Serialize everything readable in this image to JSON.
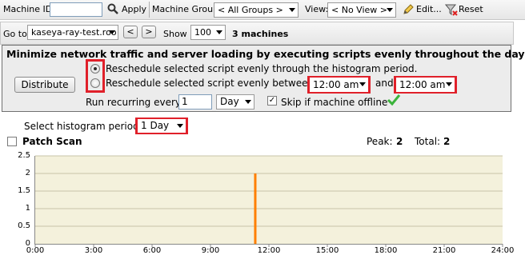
{
  "filter_bar": {
    "machine_id_label": "Machine ID:",
    "machine_id_value": "",
    "apply_label": "Apply",
    "machine_group_label": "Machine Group:",
    "machine_group_value": "< All Groups >",
    "view_label": "View:",
    "view_value": "< No View >",
    "edit_label": "Edit...",
    "reset_label": "Reset"
  },
  "nav_bar": {
    "goto_label": "Go to:",
    "goto_value": "kaseya-ray-test.roo",
    "prev_label": "<",
    "next_label": ">",
    "show_label": "Show",
    "show_value": "100",
    "machine_count": "3 machines"
  },
  "distribute_panel": {
    "title": "Minimize network traffic and server loading by executing scripts evenly throughout the day",
    "distribute_button": "Distribute",
    "option1_label": "Reschedule selected script evenly through the histogram period.",
    "option2_label": "Reschedule selected script evenly between",
    "start_time": "12:00 am",
    "and_label": "and",
    "end_time": "12:00 am",
    "run_recurring_label": "Run recurring every",
    "recurring_value": "1",
    "recurring_unit": "Day",
    "skip_offline_label": "Skip if machine offline",
    "option1_selected": true
  },
  "histogram": {
    "period_label": "Select histogram period",
    "period_value": "1 Day",
    "script_name": "Patch Scan",
    "peak_label": "Peak:",
    "peak_value": "2",
    "total_label": "Total:",
    "total_value": "2"
  },
  "chart_data": {
    "type": "bar",
    "y_ticks": [
      "0",
      "0.5",
      "1",
      "1.5",
      "2",
      "2.5"
    ],
    "x_ticks": [
      "0:00",
      "3:00",
      "6:00",
      "9:00",
      "12:00",
      "15:00",
      "18:00",
      "21:00",
      "24:00"
    ],
    "ylim": [
      0,
      2.5
    ],
    "xlim_hours": [
      0,
      24
    ],
    "bars": [
      {
        "hour": 11.3,
        "value": 2
      }
    ],
    "bar_color": "#ff7f00",
    "plot_background": "#f4f1dc",
    "grid": true
  }
}
